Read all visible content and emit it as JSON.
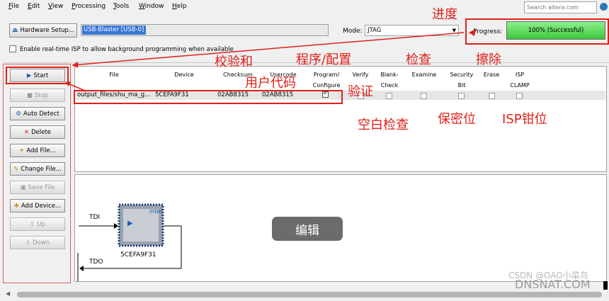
{
  "menu": [
    {
      "accel": "F",
      "rest": "ile"
    },
    {
      "accel": "E",
      "rest": "dit"
    },
    {
      "accel": "V",
      "rest": "iew"
    },
    {
      "accel": "P",
      "rest": "rocessing"
    },
    {
      "accel": "T",
      "rest": "ools"
    },
    {
      "accel": "W",
      "rest": "indow"
    },
    {
      "accel": "H",
      "rest": "elp"
    }
  ],
  "search": {
    "placeholder": "Search altera.com"
  },
  "hardware": {
    "button_label": "Hardware Setup...",
    "value": "USB-Blaster [USB-0]"
  },
  "mode": {
    "label": "Mode:",
    "value": "JTAG"
  },
  "progress": {
    "label": "Progress:",
    "text": "100% (Successful)",
    "percent": 100
  },
  "isp": {
    "label": "Enable real-time ISP to allow background programming when available",
    "checked": false
  },
  "buttons": {
    "start": "Start",
    "stop": "Stop",
    "auto_detect": "Auto Detect",
    "delete": "Delete",
    "add_file": "Add File...",
    "change_file": "Change File...",
    "save_file": "Save File",
    "add_device": "Add Device...",
    "up": "Up",
    "down": "Down"
  },
  "table": {
    "headers": [
      "File",
      "Device",
      "Checksum",
      "Usercode",
      "Program/\nConfigure",
      "Verify",
      "Blank-\nCheck",
      "Examine",
      "Security\nBit",
      "Erase",
      "ISP\nCLAMP"
    ],
    "row": {
      "file": "output_files/shu_ma_g...",
      "device": "5CEFA9F31",
      "checksum": "02AB8315",
      "usercode": "02AB8315",
      "program_configure": true,
      "verify": false,
      "blank_check": false,
      "examine": false,
      "security_bit": false,
      "erase": false,
      "isp_clamp": false
    }
  },
  "chain": {
    "tdi": "TDI",
    "tdo": "TDO",
    "device": "5CEFA9F31",
    "chip_logo": "intel"
  },
  "edit_label": "编辑",
  "annotations": {
    "progress": "进度",
    "checksum": "校验和",
    "usercode": "用户代码",
    "program": "程序/配置",
    "verify": "验证",
    "examine": "检查",
    "erase": "擦除",
    "blank_check": "空白检查",
    "security_bit": "保密位",
    "isp_clamp": "ISP钳位"
  },
  "watermark": {
    "line1": "CSDN @OAO小菜鸟",
    "line2": "DNSNAT.COM"
  },
  "colors": {
    "highlight_red": "#e0201a",
    "progress_green": "#3ec63e",
    "selection_blue": "#3875d7"
  }
}
